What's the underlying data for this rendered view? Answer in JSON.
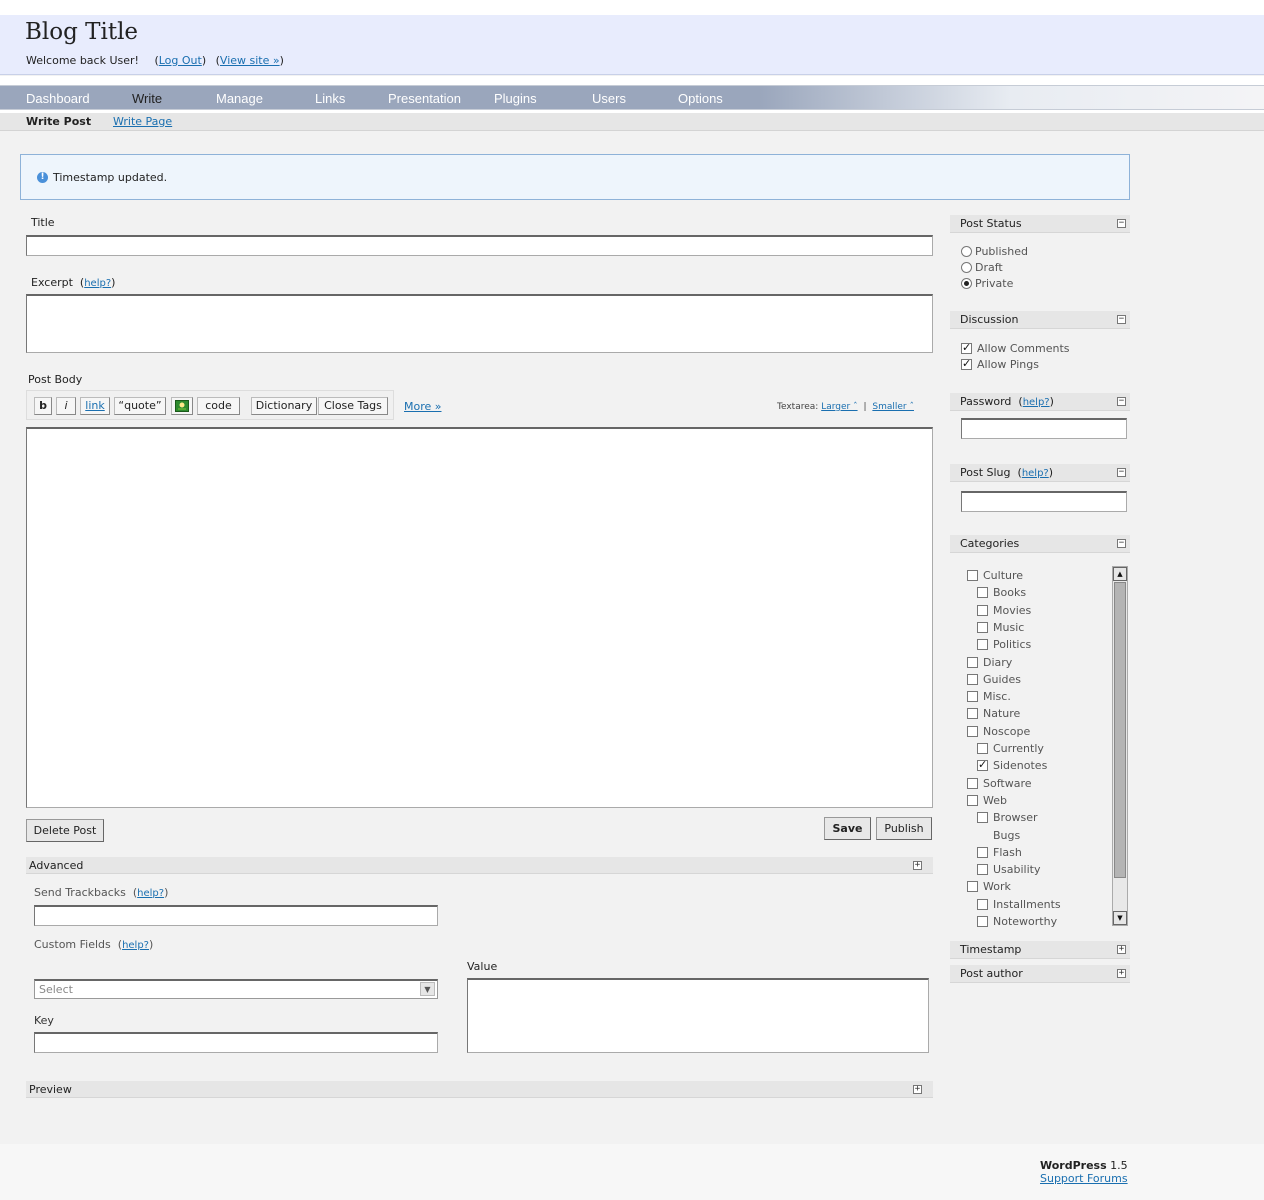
{
  "header": {
    "blog_title": "Blog Title",
    "welcome": "Welcome back User!",
    "logout_label": "Log Out",
    "view_site_label": "View site »"
  },
  "nav": {
    "items": [
      {
        "label": "Dashboard"
      },
      {
        "label": "Write"
      },
      {
        "label": "Manage"
      },
      {
        "label": "Links"
      },
      {
        "label": "Presentation"
      },
      {
        "label": "Plugins"
      },
      {
        "label": "Users"
      },
      {
        "label": "Options"
      }
    ],
    "active": "Write"
  },
  "subnav": {
    "current": "Write Post",
    "other": "Write Page"
  },
  "notice": {
    "icon": "info-icon",
    "icon_glyph": "!",
    "message": "Timestamp updated."
  },
  "form": {
    "title_label": "Title",
    "title_value": "",
    "excerpt_label": "Excerpt",
    "excerpt_help": "help?",
    "post_body_label": "Post Body",
    "quicktags": [
      "b",
      "i",
      "link",
      "“quote”",
      "code",
      "Dictionary",
      "Close Tags"
    ],
    "image_button_icon": "image-icon",
    "more_link": "More »",
    "textarea_label": "Textarea:",
    "larger_link": "Larger ˆ",
    "smaller_link": "Smaller ˆ",
    "separator": "|",
    "delete_label": "Delete Post",
    "save_label": "Save",
    "publish_label": "Publish"
  },
  "advanced": {
    "title": "Advanced",
    "trackbacks_label": "Send Trackbacks",
    "trackbacks_help": "help?",
    "custom_fields_label": "Custom Fields",
    "custom_fields_help": "help?",
    "select_value": "Select",
    "key_label": "Key",
    "value_label": "Value"
  },
  "preview": {
    "title": "Preview"
  },
  "sidebar": {
    "post_status": {
      "title": "Post Status",
      "options": [
        {
          "label": "Published",
          "checked": false
        },
        {
          "label": "Draft",
          "checked": false
        },
        {
          "label": "Private",
          "checked": true
        }
      ]
    },
    "discussion": {
      "title": "Discussion",
      "options": [
        {
          "label": "Allow Comments",
          "checked": true
        },
        {
          "label": "Allow Pings",
          "checked": true
        }
      ]
    },
    "password": {
      "title": "Password",
      "help": "help?",
      "value": ""
    },
    "post_slug": {
      "title": "Post Slug",
      "help": "help?",
      "value": ""
    },
    "categories": {
      "title": "Categories",
      "items": [
        {
          "label": "Culture",
          "checked": false,
          "level": 0
        },
        {
          "label": "Books",
          "checked": false,
          "level": 1
        },
        {
          "label": "Movies",
          "checked": false,
          "level": 1
        },
        {
          "label": "Music",
          "checked": false,
          "level": 1
        },
        {
          "label": "Politics",
          "checked": false,
          "level": 1
        },
        {
          "label": "Diary",
          "checked": false,
          "level": 0
        },
        {
          "label": "Guides",
          "checked": false,
          "level": 0
        },
        {
          "label": "Misc.",
          "checked": false,
          "level": 0
        },
        {
          "label": "Nature",
          "checked": false,
          "level": 0
        },
        {
          "label": "Noscope",
          "checked": false,
          "level": 0
        },
        {
          "label": "Currently",
          "checked": false,
          "level": 1
        },
        {
          "label": "Sidenotes",
          "checked": true,
          "level": 1
        },
        {
          "label": "Software",
          "checked": false,
          "level": 0
        },
        {
          "label": "Web",
          "checked": false,
          "level": 0
        },
        {
          "label": "Browser Bugs",
          "checked": false,
          "level": 1
        },
        {
          "label": "Flash",
          "checked": false,
          "level": 1
        },
        {
          "label": "Usability",
          "checked": false,
          "level": 1
        },
        {
          "label": "Work",
          "checked": false,
          "level": 0
        },
        {
          "label": "Installments",
          "checked": false,
          "level": 1
        },
        {
          "label": "Noteworthy",
          "checked": false,
          "level": 1
        }
      ]
    },
    "timestamp": {
      "title": "Timestamp"
    },
    "post_author": {
      "title": "Post author"
    }
  },
  "footer": {
    "product": "WordPress",
    "version": "1.5",
    "support_link": "Support Forums"
  }
}
